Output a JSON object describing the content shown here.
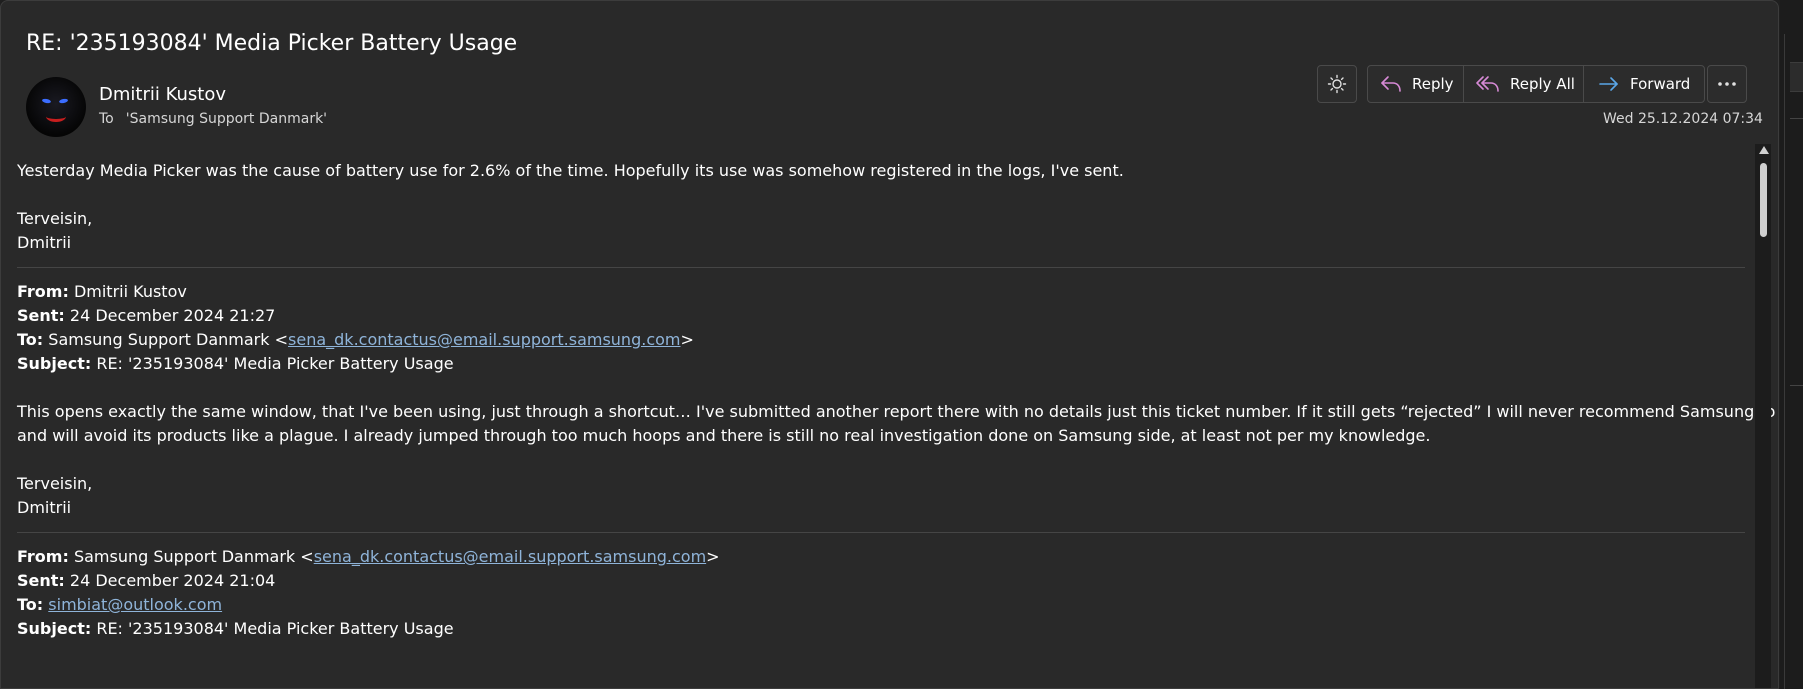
{
  "email": {
    "subject": "RE: '235193084' Media Picker Battery Usage",
    "sender": "Dmitrii Kustov",
    "to_label": "To",
    "to_value": "'Samsung Support Danmark'",
    "date": "Wed 25.12.2024 07:34"
  },
  "toolbar": {
    "reply_label": "Reply",
    "reply_all_label": "Reply All",
    "forward_label": "Forward",
    "theme_icon": "sun-icon",
    "more_icon": "ellipsis-icon"
  },
  "body": {
    "para1": "Yesterday Media Picker was the cause of battery use for 2.6% of the time. Hopefully its use was somehow registered in the logs, I've sent.",
    "signoff": "Terveisin,",
    "name": "Dmitrii",
    "quote1": {
      "from_label": "From:",
      "from_value": "Dmitrii Kustov",
      "sent_label": "Sent:",
      "sent_value": "24 December 2024 21:27",
      "to_label": "To:",
      "to_name": "Samsung Support Danmark <",
      "to_email": "sena_dk.contactus@email.support.samsung.com",
      "to_close": ">",
      "subject_label": "Subject:",
      "subject_value": "RE: '235193084' Media Picker Battery Usage",
      "body_line1": "This opens exactly the same window, that I've been using, just through a shortcut… I've submitted another report there with no details just this ticket number. If it still gets “rejected” I will never recommend Samsung to anyone",
      "body_line2": "and will avoid its products like a plague. I already jumped through too much hoops and there is still no real investigation done on Samsung side, at least not per my knowledge.",
      "signoff": "Terveisin,",
      "name": "Dmitrii"
    },
    "quote2": {
      "from_label": "From:",
      "from_name": "Samsung Support Danmark <",
      "from_email": "sena_dk.contactus@email.support.samsung.com",
      "from_close": ">",
      "sent_label": "Sent:",
      "sent_value": "24 December 2024 21:04",
      "to_label": "To:",
      "to_email": "simbiat@outlook.com",
      "subject_label": "Subject:",
      "subject_value": "RE: '235193084' Media Picker Battery Usage"
    }
  },
  "colors": {
    "background": "#292929",
    "link": "#8fb4d9",
    "reply_icon": "#d78ad6",
    "forward_icon": "#5aa7e8"
  }
}
